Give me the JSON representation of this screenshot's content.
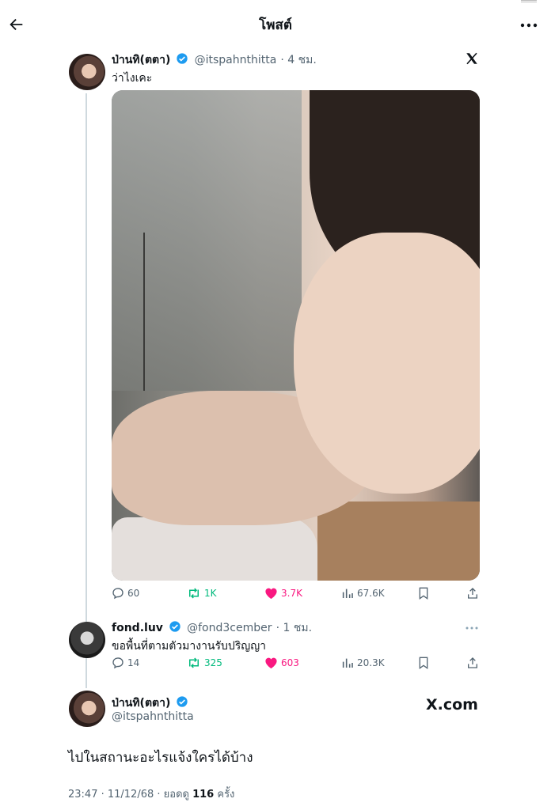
{
  "header": {
    "title": "โพสต์"
  },
  "tweet": {
    "name": "ป่านทิ(ตตา)",
    "handle": "@itspahnthitta",
    "time": "· 4 ชม.",
    "text": "ว่าไงเคะ",
    "stats": {
      "replies": "60",
      "reposts": "1K",
      "likes": "3.7K",
      "views": "67.6K"
    }
  },
  "reply": {
    "name": "fond.luv",
    "handle": "@fond3cember",
    "time": "· 1 ชม.",
    "text": "ขอพื้นที่ตามตัวมางานรับปริญญา",
    "stats": {
      "replies": "14",
      "reposts": "325",
      "likes": "603",
      "views": "20.3K"
    }
  },
  "main_post": {
    "name": "ป่านทิ(ตตา)",
    "handle": "@itspahnthitta",
    "site": "X.com",
    "text": "ไปในสถานะอะไรแจ้งใครได้บ้าง",
    "timestamp": "23:47 · 11/12/68 · ยอดดู",
    "views": "116",
    "views_unit": "ครั้ง"
  },
  "colors": {
    "verified": "#1d9bf0",
    "repost": "#00ba7c",
    "like": "#f91880",
    "muted": "#536471"
  }
}
